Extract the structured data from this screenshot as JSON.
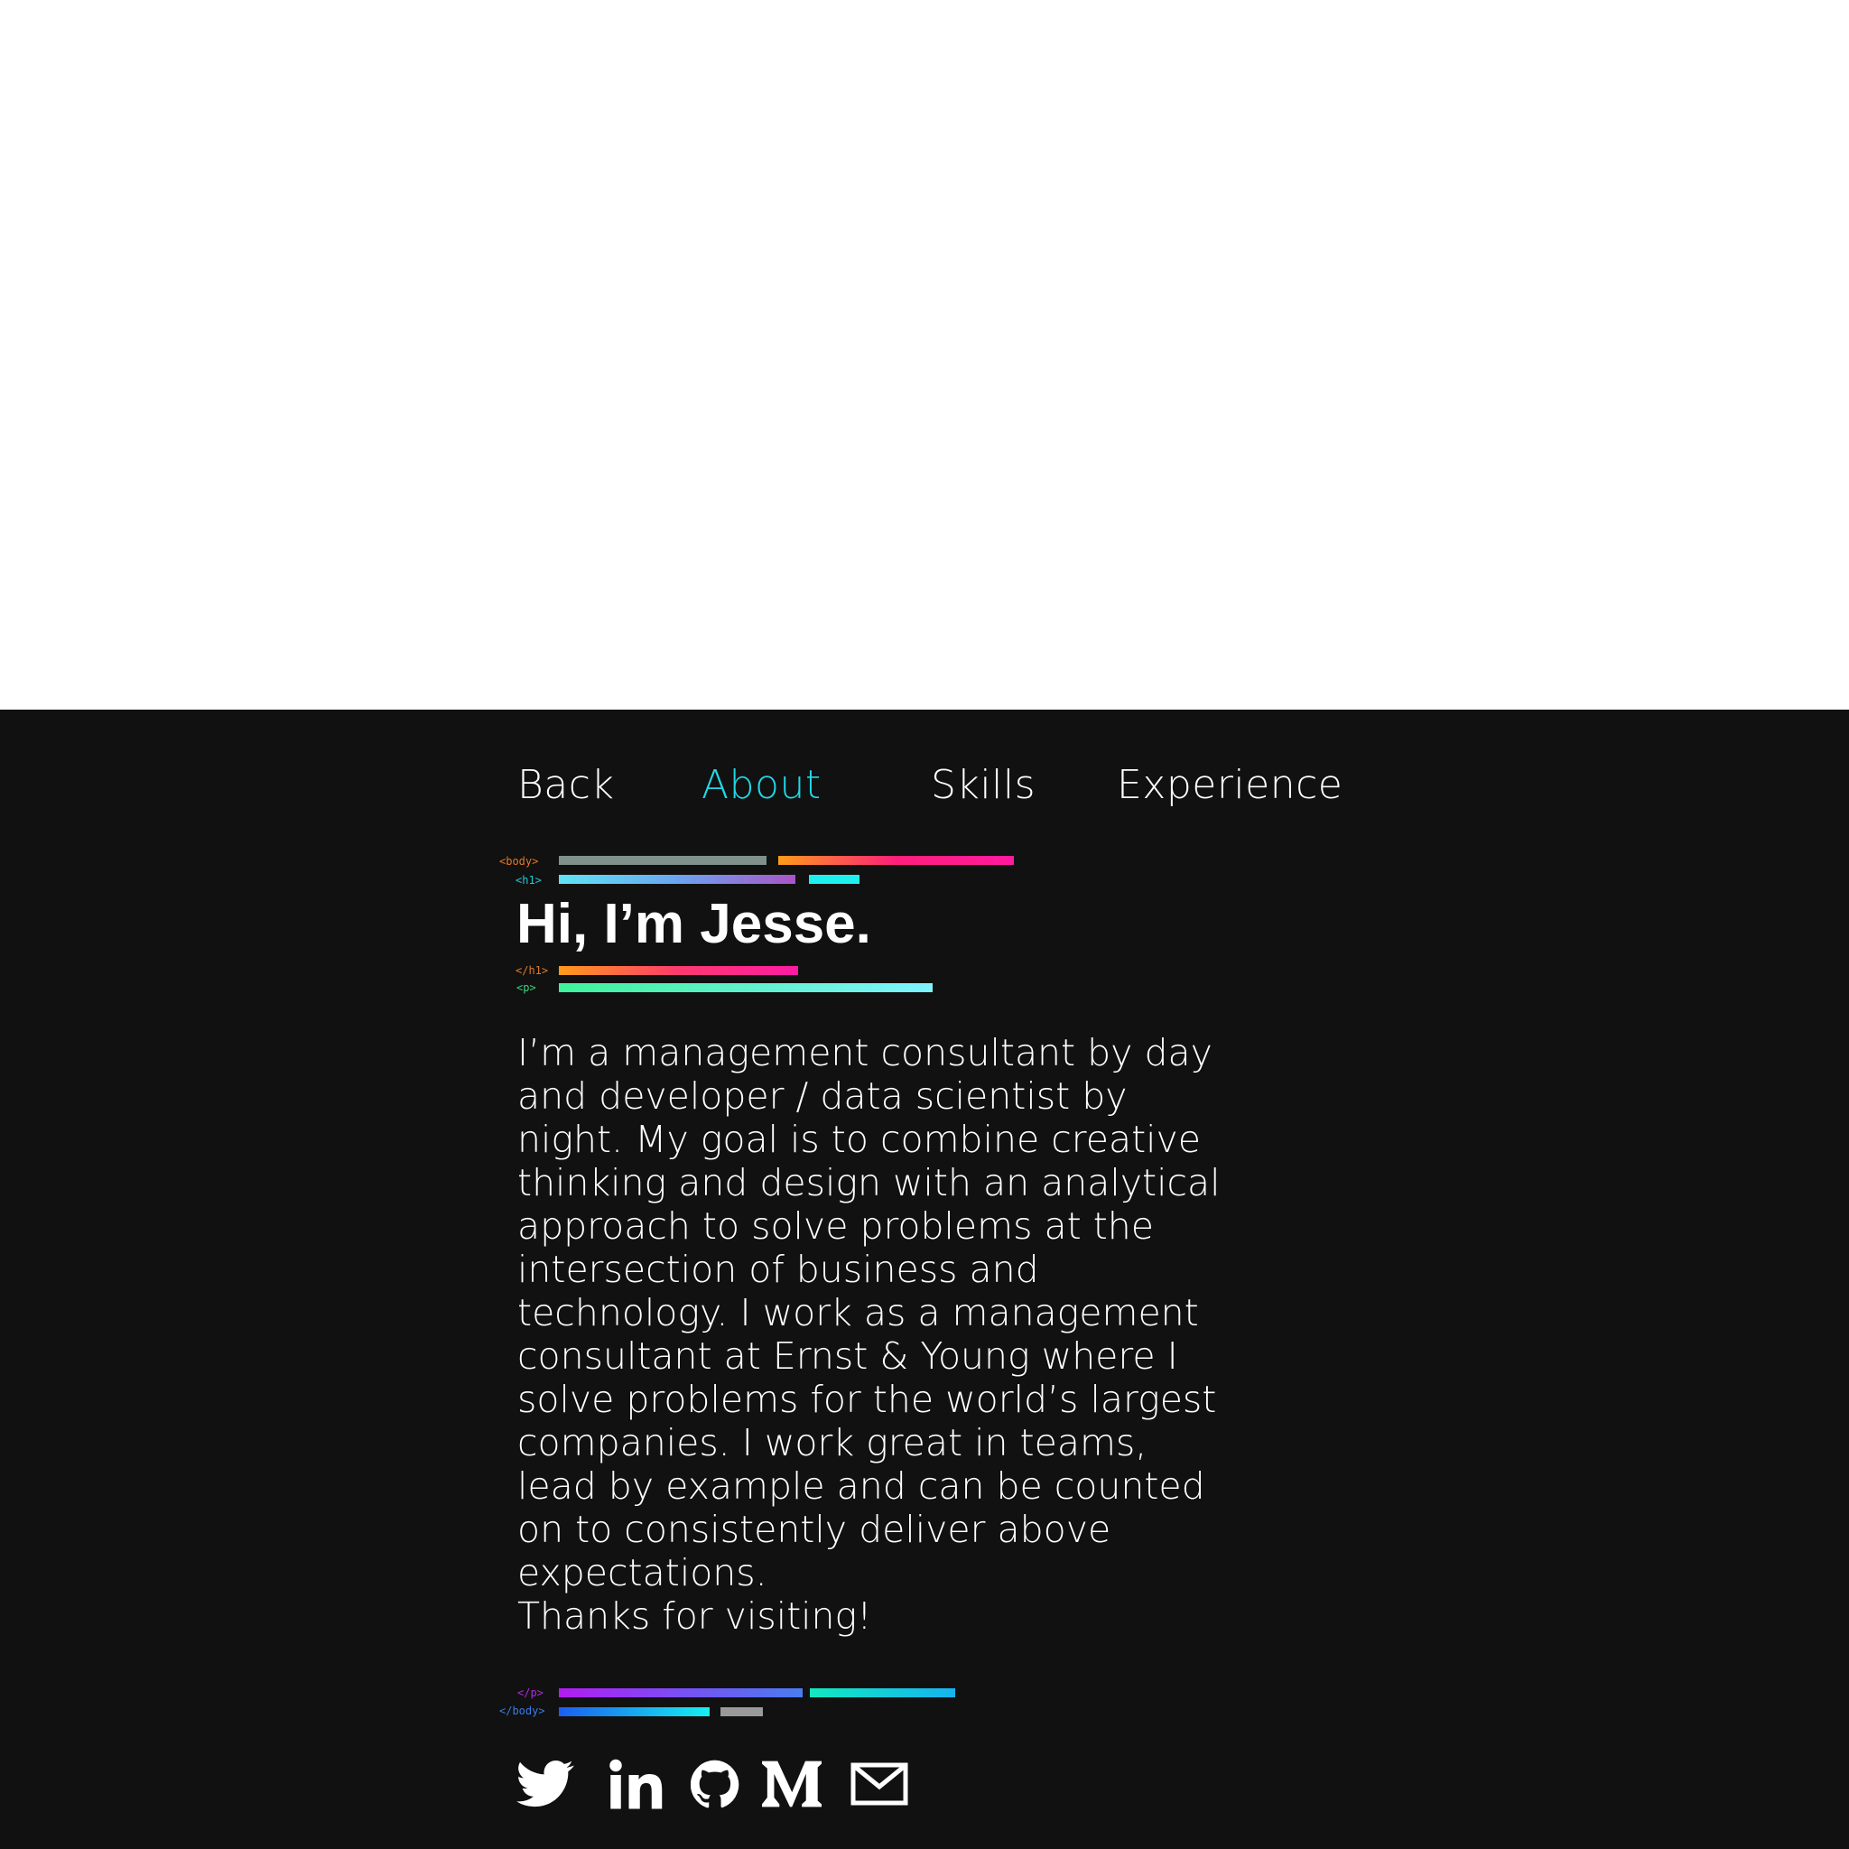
{
  "nav": {
    "back": "Back",
    "about": "About",
    "skills": "Skills",
    "experience": "Experience",
    "active": "About"
  },
  "tags": {
    "body_open": "<body>",
    "h1_open": "<h1>",
    "h1_close": "</h1>",
    "p_open": "<p>",
    "p_close": "</p>",
    "body_close": "</body>"
  },
  "heading": "Hi, I’m Jesse.",
  "bio_lines": [
    "I’m a management consultant by day",
    "and developer / data scientist by",
    "night. My goal is to combine creative",
    "thinking and design with an analytical",
    "approach to solve problems at the",
    "intersection of business and",
    "technology. I work as a management",
    "consultant at Ernst & Young where I",
    "solve problems for the world’s largest",
    "companies. I work great in teams,",
    "lead by example and can be counted",
    "on to consistently deliver above",
    "expectations.",
    "Thanks for visiting!"
  ],
  "social": [
    "twitter-icon",
    "linkedin-icon",
    "github-icon",
    "medium-icon",
    "email-icon"
  ],
  "colors": {
    "background": "#111111",
    "top_area": "#ffffff",
    "text": "#ffffff",
    "accent": "#22d8e6"
  }
}
